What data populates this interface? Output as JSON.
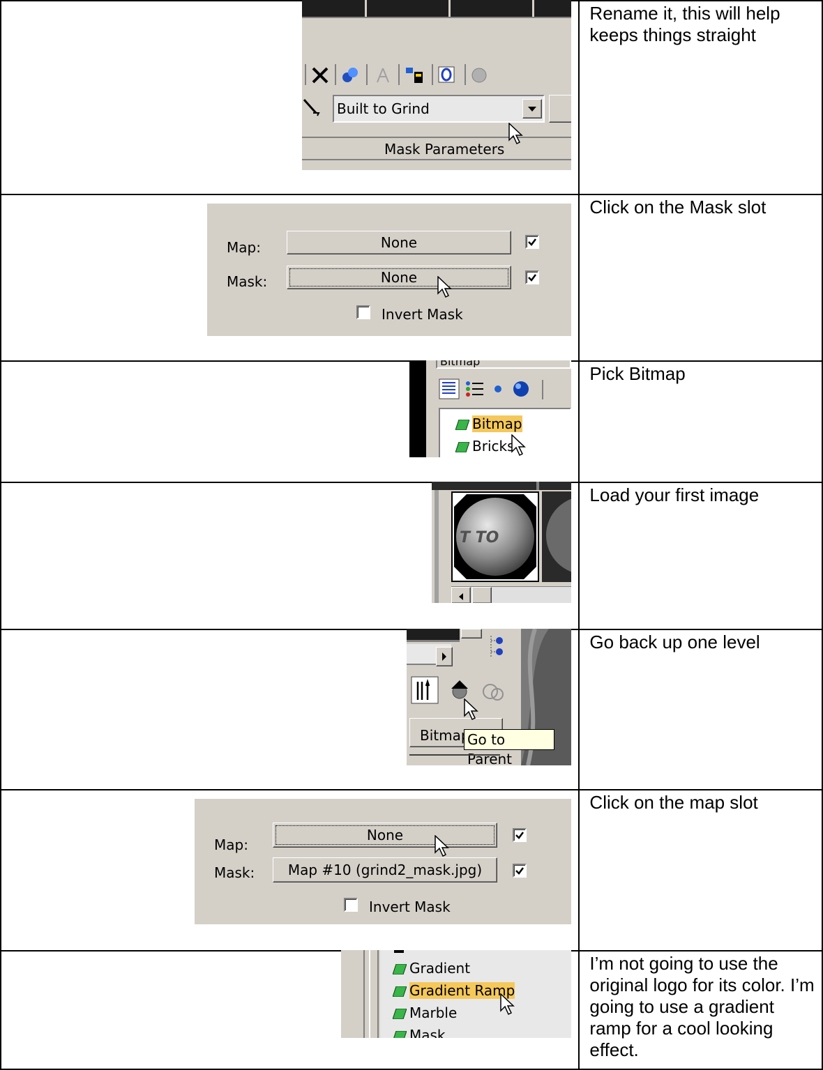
{
  "rows": [
    {
      "text": "Rename it, this will help keeps things straight",
      "shot": {
        "material_name": "Built to Grind",
        "rollout_title": "Mask Parameters"
      }
    },
    {
      "text": "Click on the Mask slot",
      "shot": {
        "map_label": "Map:",
        "map_value": "None",
        "mask_label": "Mask:",
        "mask_value": "None",
        "invert_label": "Invert Mask"
      }
    },
    {
      "text": "Pick Bitmap",
      "shot": {
        "top_partial": "Bitmap",
        "items": [
          "Bitmap",
          "Bricks"
        ]
      }
    },
    {
      "text": "Load your first image",
      "shot": {
        "sphere_text": "T TO"
      }
    },
    {
      "text": "Go back up one level",
      "shot": {
        "button_label": "Bitmap",
        "tooltip": "Go to Parent"
      }
    },
    {
      "text": "Click on the map slot",
      "shot": {
        "map_label": "Map:",
        "map_value": "None",
        "mask_label": "Mask:",
        "mask_value": "Map #10 (grind2_mask.jpg)",
        "invert_label": "Invert Mask"
      }
    },
    {
      "text": "I’m not going to use the original logo for its color. I’m going to use a gradient ramp for a cool looking effect.",
      "shot": {
        "items": [
          "Gradient",
          "Gradient Ramp",
          "Marble",
          "Mask"
        ]
      }
    }
  ],
  "colors": {
    "ui_gray": "#d4d0c8",
    "highlight": "#f5c85a",
    "map_icon": "#39b54a",
    "tooltip_bg": "#ffffe1"
  }
}
